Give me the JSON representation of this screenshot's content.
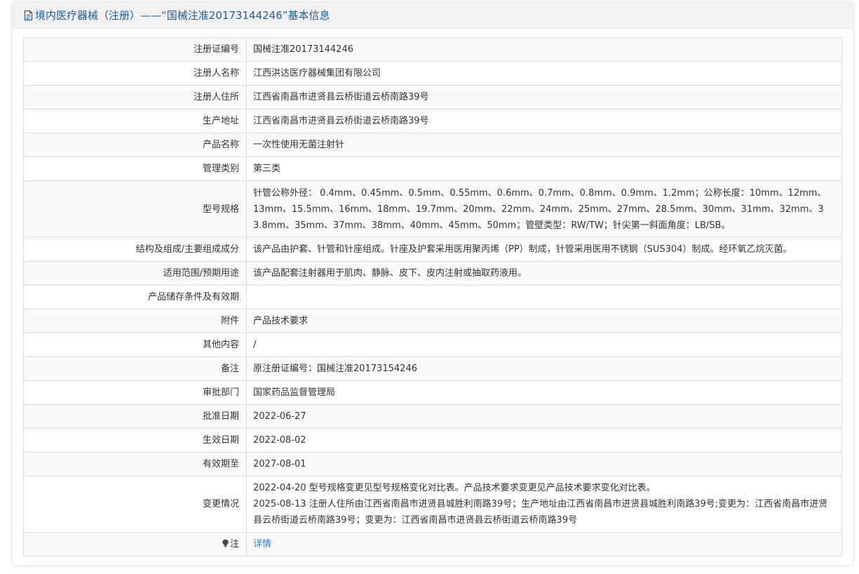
{
  "header": {
    "title": "境内医疗器械（注册）——“国械注准20173144246”基本信息",
    "icon": "document-icon"
  },
  "rows": [
    {
      "label": "注册证编号",
      "value": "国械注准20173144246"
    },
    {
      "label": "注册人名称",
      "value": "江西洪达医疗器械集团有限公司"
    },
    {
      "label": "注册人住所",
      "value": "江西省南昌市进贤县云桥街道云桥南路39号"
    },
    {
      "label": "生产地址",
      "value": "江西省南昌市进贤县云桥街道云桥南路39号"
    },
    {
      "label": "产品名称",
      "value": "一次性使用无菌注射针"
    },
    {
      "label": "管理类别",
      "value": "第三类"
    },
    {
      "label": "型号规格",
      "value": "针管公称外径： 0.4mm、0.45mm、0.5mm、0.55mm、0.6mm、0.7mm、0.8mm、0.9mm、1.2mm；公称长度：10mm、12mm、13mm、15.5mm、16mm、18mm、19.7mm、20mm、22mm、24mm、25mm、27mm、28.5mm、30mm、31mm、32mm、33.8mm、35mm、37mm、38mm、40mm、45mm、50mm；管壁类型：RW/TW；针尖第一斜面角度：LB/SB。"
    },
    {
      "label": "结构及组成/主要组成成分",
      "value": "该产品由护套、针管和针座组成。针座及护套采用医用聚丙烯（PP）制成，针管采用医用不锈钢（SUS304）制成。经环氧乙烷灭菌。"
    },
    {
      "label": "适用范围/预期用途",
      "value": "该产品配套注射器用于肌肉、静脉、皮下、皮内注射或抽取药液用。"
    },
    {
      "label": "产品储存条件及有效期",
      "value": ""
    },
    {
      "label": "附件",
      "value": "产品技术要求"
    },
    {
      "label": "其他内容",
      "value": "/"
    },
    {
      "label": "备注",
      "value": "原注册证编号：国械注准20173154246"
    },
    {
      "label": "审批部门",
      "value": "国家药品监督管理局"
    },
    {
      "label": "批准日期",
      "value": "2022-06-27"
    },
    {
      "label": "生效日期",
      "value": "2022-08-02"
    },
    {
      "label": "有效期至",
      "value": "2027-08-01"
    }
  ],
  "changes": {
    "label": "变更情况",
    "lines": [
      "2022-04-20 型号规格变更见型号规格变化对比表。产品技术要求变更见产品技术要求变化对比表。",
      "2025-08-13 注册人住所由江西省南昌市进贤县城胜利南路39号；生产地址由江西省南昌市进贤县城胜利南路39号;变更为：江西省南昌市进贤县云桥街道云桥南路39号；变更为：江西省南昌市进贤县云桥街道云桥南路39号"
    ]
  },
  "note": {
    "label": "注",
    "icon": "lightbulb-icon",
    "link_text": "详情"
  },
  "colors": {
    "title": "#1f5c99",
    "link": "#2a7ed3",
    "border": "#dddddd",
    "header_bg": "#f1f1f1"
  }
}
